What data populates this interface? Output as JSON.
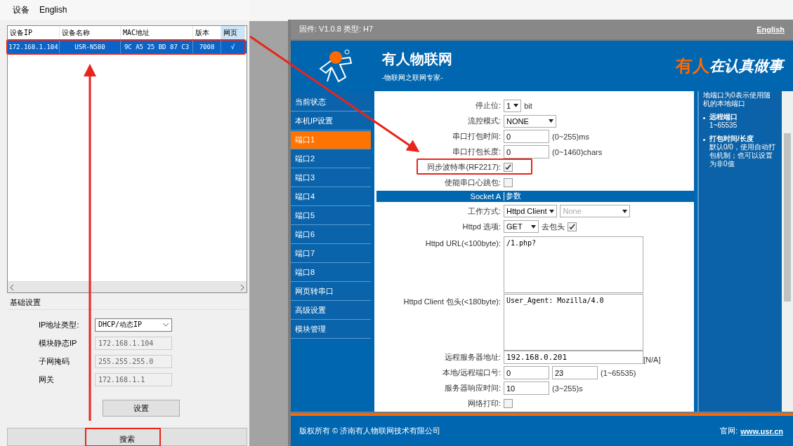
{
  "tool": {
    "menu": [
      {
        "label": "设备"
      },
      {
        "label": "English"
      }
    ],
    "columns": [
      {
        "label": "设备IP",
        "highlighted": false
      },
      {
        "label": "设备名称",
        "highlighted": false
      },
      {
        "label": "MAC地址",
        "highlighted": false
      },
      {
        "label": "版本",
        "highlighted": false
      },
      {
        "label": "网页",
        "highlighted": true
      }
    ],
    "rows": [
      {
        "cells": [
          "172.168.1.104",
          "USR-N580",
          "9C A5 25 BD 87 C3",
          "7008",
          "√"
        ],
        "selected": true,
        "highlighted": true
      }
    ],
    "group_title": "基础设置",
    "fields": [
      {
        "kind": "select",
        "label": "IP地址类型:",
        "value": "DHCP/动态IP",
        "disabled": false
      },
      {
        "kind": "input",
        "label": "模块静态IP",
        "value": "172.168.1.104",
        "disabled": true
      },
      {
        "kind": "input",
        "label": "子网掩码",
        "value": "255.255.255.0",
        "disabled": true
      },
      {
        "kind": "input",
        "label": "网关",
        "value": "172.168.1.1",
        "disabled": true
      }
    ],
    "set_button": "设置",
    "search_button": {
      "label": "搜索",
      "highlighted": true
    }
  },
  "browser": {
    "info": "固件: V1.0.8 类型: H7",
    "language_link": "English",
    "brand": "有人物联网",
    "tagline": "-物联网之联网专家-",
    "slogan_accent": "有人",
    "slogan": "在认真做事",
    "nav": [
      {
        "label": "当前状态",
        "selected": false
      },
      {
        "label": "本机IP设置",
        "selected": false
      },
      {
        "label": "端口1",
        "selected": true
      },
      {
        "label": "端口2",
        "selected": false
      },
      {
        "label": "端口3",
        "selected": false
      },
      {
        "label": "端口4",
        "selected": false
      },
      {
        "label": "端口5",
        "selected": false
      },
      {
        "label": "端口6",
        "selected": false
      },
      {
        "label": "端口7",
        "selected": false
      },
      {
        "label": "端口8",
        "selected": false
      },
      {
        "label": "网页转串口",
        "selected": false
      },
      {
        "label": "高级设置",
        "selected": false
      },
      {
        "label": "模块管理",
        "selected": false
      }
    ],
    "form": [
      {
        "kind": "select",
        "label": "停止位:",
        "value": "1",
        "suffix": "bit"
      },
      {
        "kind": "select",
        "label": "流控模式:",
        "value": "NONE"
      },
      {
        "kind": "input",
        "label": "串口打包时间:",
        "value": "0",
        "suffix": "(0~255)ms"
      },
      {
        "kind": "input",
        "label": "串口打包长度:",
        "value": "0",
        "suffix": "(0~1460)chars"
      },
      {
        "kind": "checkbox",
        "label": "同步波特率(RF2217):",
        "checked": true,
        "highlighted": true
      },
      {
        "kind": "checkbox",
        "label": "使能串口心跳包:",
        "checked": false,
        "highlighted": false
      },
      {
        "kind": "header",
        "label": "Socket A",
        "value": "参数"
      },
      {
        "kind": "select2",
        "label": "工作方式:",
        "value": "Httpd Client",
        "value2": "None"
      },
      {
        "kind": "selectcheck",
        "label": "Httpd 选项:",
        "value": "GET",
        "check_label": "去包头",
        "checked": true
      },
      {
        "kind": "textarea",
        "label": "Httpd URL(<100byte):",
        "value": "/1.php?"
      },
      {
        "kind": "textarea",
        "label": "Httpd Client 包头(<180byte):",
        "value": "User_Agent: Mozilla/4.0"
      },
      {
        "kind": "wide",
        "label": "远程服务器地址:",
        "value": "192.168.0.201",
        "suffix": "[N/A]"
      },
      {
        "kind": "input2",
        "label": "本地/远程端口号:",
        "value": "0",
        "value2": "23",
        "suffix": "(1~65535)"
      },
      {
        "kind": "input",
        "label": "服务器响应时间:",
        "value": "10",
        "suffix": "(3~255)s"
      },
      {
        "kind": "checkbox",
        "label": "网络打印:",
        "checked": false,
        "highlighted": false
      }
    ],
    "help": [
      {
        "text": "地端口为0表示使用随机的本地端口"
      },
      {
        "title": "远程端口",
        "text": "1~65535"
      },
      {
        "title": "打包时间/长度",
        "text": "默认0/0，使用自动打包机制；也可以设置为非0值"
      }
    ],
    "footer": "版权所有 © 济南有人物联网技术有限公司",
    "site_label": "官网:",
    "site_link": "www.usr.cn"
  }
}
